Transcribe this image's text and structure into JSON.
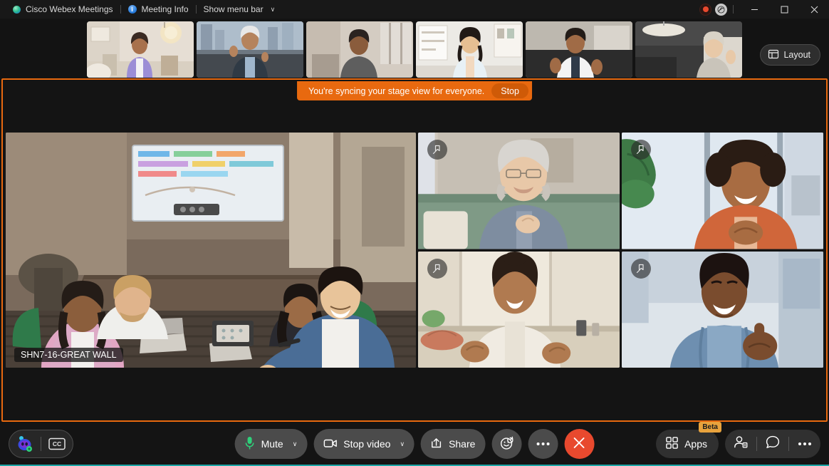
{
  "window": {
    "app_name": "Cisco Webex Meetings",
    "meeting_info": "Meeting Info",
    "show_menu_bar": "Show menu bar",
    "chevron": "∨",
    "recording_icon": "recording-indicator-icon",
    "network_icon": "network-status-icon",
    "minimize_label": "Minimize",
    "maximize_label": "Maximize",
    "close_label": "Close"
  },
  "filmstrip": {
    "layout_button": "Layout",
    "layout_icon": "layout-grid-icon",
    "thumbnails": [
      {
        "name": "participant-thumbnail-1"
      },
      {
        "name": "participant-thumbnail-2"
      },
      {
        "name": "participant-thumbnail-3"
      },
      {
        "name": "participant-thumbnail-4"
      },
      {
        "name": "participant-thumbnail-5"
      },
      {
        "name": "participant-thumbnail-6"
      }
    ]
  },
  "stage": {
    "sync_banner_text": "You're syncing your stage view for everyone.",
    "stop_button": "Stop",
    "main_video_name": "SHN7-16-GREAT WALL",
    "pin_icon": "pin-to-stage-icon",
    "cells": [
      {
        "name": "stage-video-top-left"
      },
      {
        "name": "stage-video-top-right"
      },
      {
        "name": "stage-video-bottom-left"
      },
      {
        "name": "stage-video-bottom-right"
      }
    ]
  },
  "controls": {
    "ai_assistant_icon": "webex-ai-assistant-icon",
    "captions_icon": "closed-captions-icon",
    "captions_label": "CC",
    "mute": "Mute",
    "mute_icon": "microphone-icon",
    "stop_video": "Stop video",
    "video_icon": "camera-icon",
    "share": "Share",
    "share_icon": "share-screen-icon",
    "reactions_icon": "reactions-smiley-icon",
    "more_icon": "more-options-icon",
    "end_icon": "end-meeting-icon",
    "apps": "Apps",
    "apps_icon": "apps-grid-icon",
    "beta_badge": "Beta",
    "participants_icon": "participants-icon",
    "chat_icon": "chat-bubble-icon",
    "more_right_icon": "more-options-right-icon",
    "caret": "∨"
  },
  "colors": {
    "accent_orange": "#e8690f",
    "end_red": "#e8492e",
    "beta_amber": "#e8a33d",
    "bottom_accent": "#1aa6a6"
  }
}
